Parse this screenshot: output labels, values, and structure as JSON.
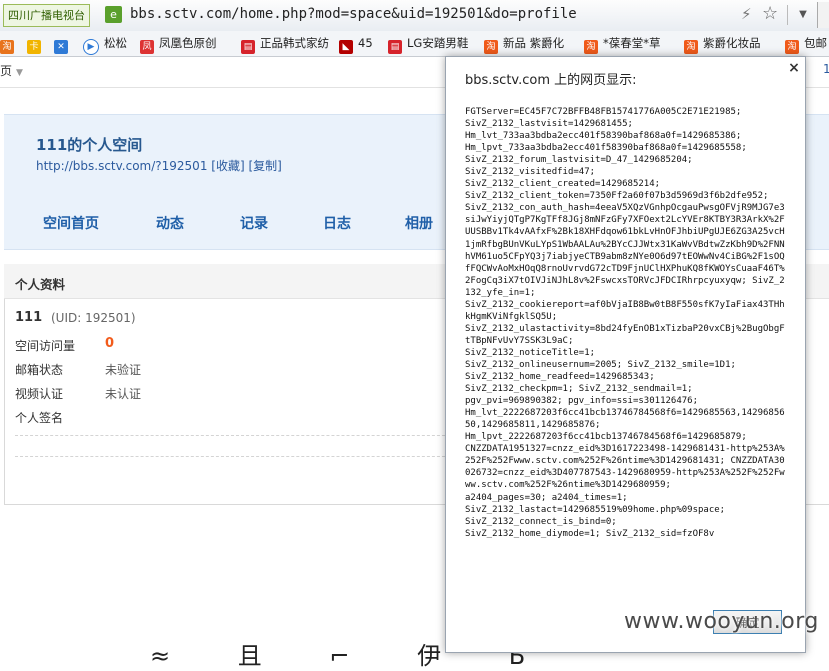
{
  "browser": {
    "site_tag": "四川广播电视台",
    "mode_icon": "ie-compat-icon",
    "url": "bbs.sctv.com/home.php?mod=space&uid=192501&do=profile"
  },
  "favorites": [
    {
      "label": "",
      "icon": "taobao-icon"
    },
    {
      "label": "",
      "icon": "cart-icon"
    },
    {
      "label": "",
      "icon": "x-icon"
    },
    {
      "label": "松松",
      "icon": "play-icon"
    },
    {
      "label": "凤凰色原创",
      "icon": "calendar-icon"
    },
    {
      "label": "正品韩式家纺",
      "icon": "doc-icon"
    },
    {
      "label": "45",
      "icon": "flag-icon"
    },
    {
      "label": "LG安踏男鞋",
      "icon": "doc-icon"
    },
    {
      "label": "新品 紫爵化",
      "icon": "taobao-icon"
    },
    {
      "label": "*葆春堂*草",
      "icon": "taobao-icon"
    },
    {
      "label": "紫爵化妆品",
      "icon": "taobao-icon"
    },
    {
      "label": "包邮",
      "icon": "taobao-icon"
    }
  ],
  "page": {
    "menu_label": "页",
    "right_fragment": "1",
    "space_title": "111的个人空间",
    "space_url": "http://bbs.sctv.com/?192501",
    "fav_link": "[收藏]",
    "copy_link": "[复制]",
    "nav": [
      "空间首页",
      "动态",
      "记录",
      "日志",
      "相册"
    ],
    "profile": {
      "header": "个人资料",
      "username": "111",
      "uid": "(UID: 192501)",
      "rows": [
        {
          "label": "空间访问量",
          "value": "0"
        },
        {
          "label": "邮箱状态",
          "value": "未验证"
        },
        {
          "label": "视频认证",
          "value": "未认证"
        },
        {
          "label": "个人签名",
          "value": ""
        }
      ]
    }
  },
  "dialog": {
    "title": "bbs.sctv.com 上的网页显示:",
    "close": "×",
    "message": "FGTServer=EC45F7C72BFFB48FB15741776A005C2E71E21985;\nSivZ_2132_lastvisit=1429681455;\nHm_lvt_733aa3bdba2ecc401f58390baf868a0f=1429685386;\nHm_lpvt_733aa3bdba2ecc401f58390baf868a0f=1429685558;\nSivZ_2132_forum_lastvisit=D_47_1429685204;\nSivZ_2132_visitedfid=47;\nSivZ_2132_client_created=1429685214;\nSivZ_2132_client_token=7350Ff2a60f07b3d5969d3f6b2dfe952;\nSivZ_2132_con_auth_hash=4eeaV5XQzVGnhpOcgauPwsgOFVjR9MJG7e3siJwYiyjQTgP7KgTFf8JGj8mNFzGFy7XFOext2LcYVEr8KTBY3R3ArkX%2FUUSBBv1Tk4vAAfxF%2Bk18XHFdqow61bkLvHnOFJhbiUPgUJE6ZG3A25vcH1jmRfbgBUnVKuLYpS1WbAALAu%2BYcCJJWtx31KaWvVBdtwZzKbh9D%2FNNhVM61uo5CFpYQ3j7iabjyeCTB9abm8zNYe0O6d97tEOWwNv4CiBG%2F1sOQfFQCWvAoMxHOqQ8rnoUvrvdG72cTD9FjnUClHXPhuKQ8fKWOYsCuaaF46T%2FogCq3iX7tOIVJiNJhL8v%2FswcxsTORVcJFDCIRhrpcyuxyqw; SivZ_2132_yfe_in=1;\nSivZ_2132_cookiereport=af0bVjaIB8Bw0tB8F550sfK7yIaFiax43THhkHgmKViNfgklSQ5U;\nSivZ_2132_ulastactivity=8bd24fyEnOB1xTizbaP20vxCBj%2BugObgFtTBpNFvUvY7SSK3L9aC;\nSivZ_2132_noticeTitle=1;\nSivZ_2132_onlineusernum=2005; SivZ_2132_smile=1D1;\nSivZ_2132_home_readfeed=1429685343;\nSivZ_2132_checkpm=1; SivZ_2132_sendmail=1;\npgv_pvi=969890382; pgv_info=ssi=s301126476;\nHm_lvt_2222687203f6cc41bcb13746784568f6=1429685563,1429685650,1429685811,1429685876;\nHm_lpvt_2222687203f6cc41bcb13746784568f6=1429685879;\nCNZZDATA1951327=cnzz_eid%3D1617223498-1429681431-http%253A%252F%252Fwww.sctv.com%252F%26ntime%3D1429681431; CNZZDATA30026732=cnzz_eid%3D407787543-1429680959-http%253A%252F%252Fwww.sctv.com%252F%26ntime%3D1429680959;\na2404_pages=30; a2404_times=1;\nSivZ_2132_lastact=1429685519%09home.php%09space;\nSivZ_2132_connect_is_bind=0;\nSivZ_2132_home_diymode=1; SivZ_2132_sid=fzOF8v",
    "ok_label": "确定"
  },
  "watermark": "www.wooyun.org",
  "bottom_glyphs": "≈ 且 ⌐ 伊 Б"
}
